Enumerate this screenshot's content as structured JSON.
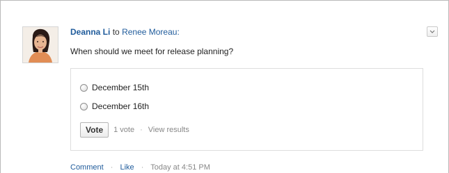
{
  "post": {
    "author": "Deanna Li",
    "connector": "to",
    "recipient": "Renee Moreau:",
    "question": "When should we meet for release planning?"
  },
  "poll": {
    "options": [
      {
        "label": "December 15th"
      },
      {
        "label": "December 16th"
      }
    ],
    "vote_button": "Vote",
    "vote_count": "1 vote",
    "separator": "·",
    "view_results": "View results"
  },
  "footer": {
    "comment": "Comment",
    "like": "Like",
    "timestamp": "Today at 4:51 PM",
    "separator": "·"
  },
  "icons": {
    "menu": "chevron-down-icon",
    "avatar": "avatar"
  },
  "colors": {
    "link": "#1f5b9b",
    "muted": "#888888",
    "border": "#dddddd"
  }
}
